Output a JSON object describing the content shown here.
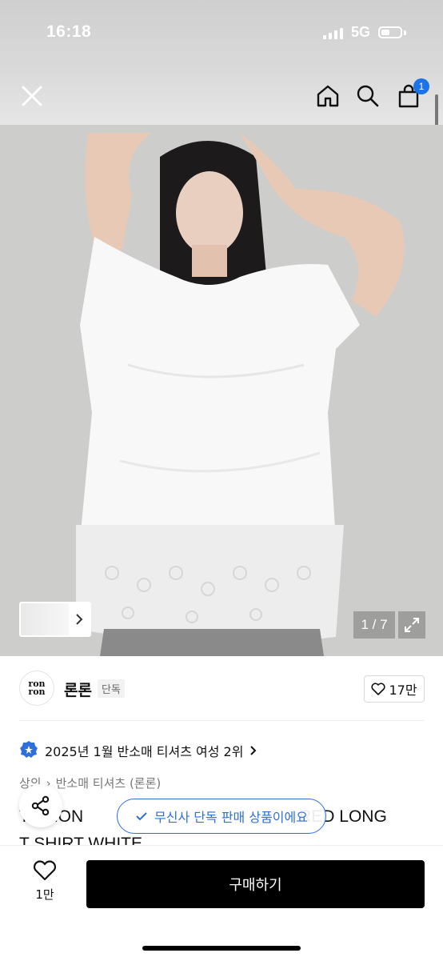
{
  "status_bar": {
    "time": "16:18",
    "network": "5G"
  },
  "header": {
    "cart_badge": "1"
  },
  "gallery": {
    "counter": "1 / 7"
  },
  "brand": {
    "logo_text": "ron ron",
    "name": "론론",
    "tag": "단독",
    "likes": "17만"
  },
  "ranking": {
    "text": "2025년 1월 반소매 티셔츠 여성 2위"
  },
  "category": {
    "parent": "상의",
    "child": "반소매 티셔츠 (론론)"
  },
  "title": {
    "line1": "T  CHON",
    "line1_end": "RED LONG",
    "line2": "T SHIRT WHITE"
  },
  "exclusive_notice": {
    "text": "무신사 단독 판매 상품이에요"
  },
  "bottom_bar": {
    "likes": "1만",
    "buy_label": "구매하기"
  },
  "colors": {
    "accent_blue": "#2f6fdb",
    "badge_blue": "#1a73e8",
    "buy_button": "#000000"
  }
}
